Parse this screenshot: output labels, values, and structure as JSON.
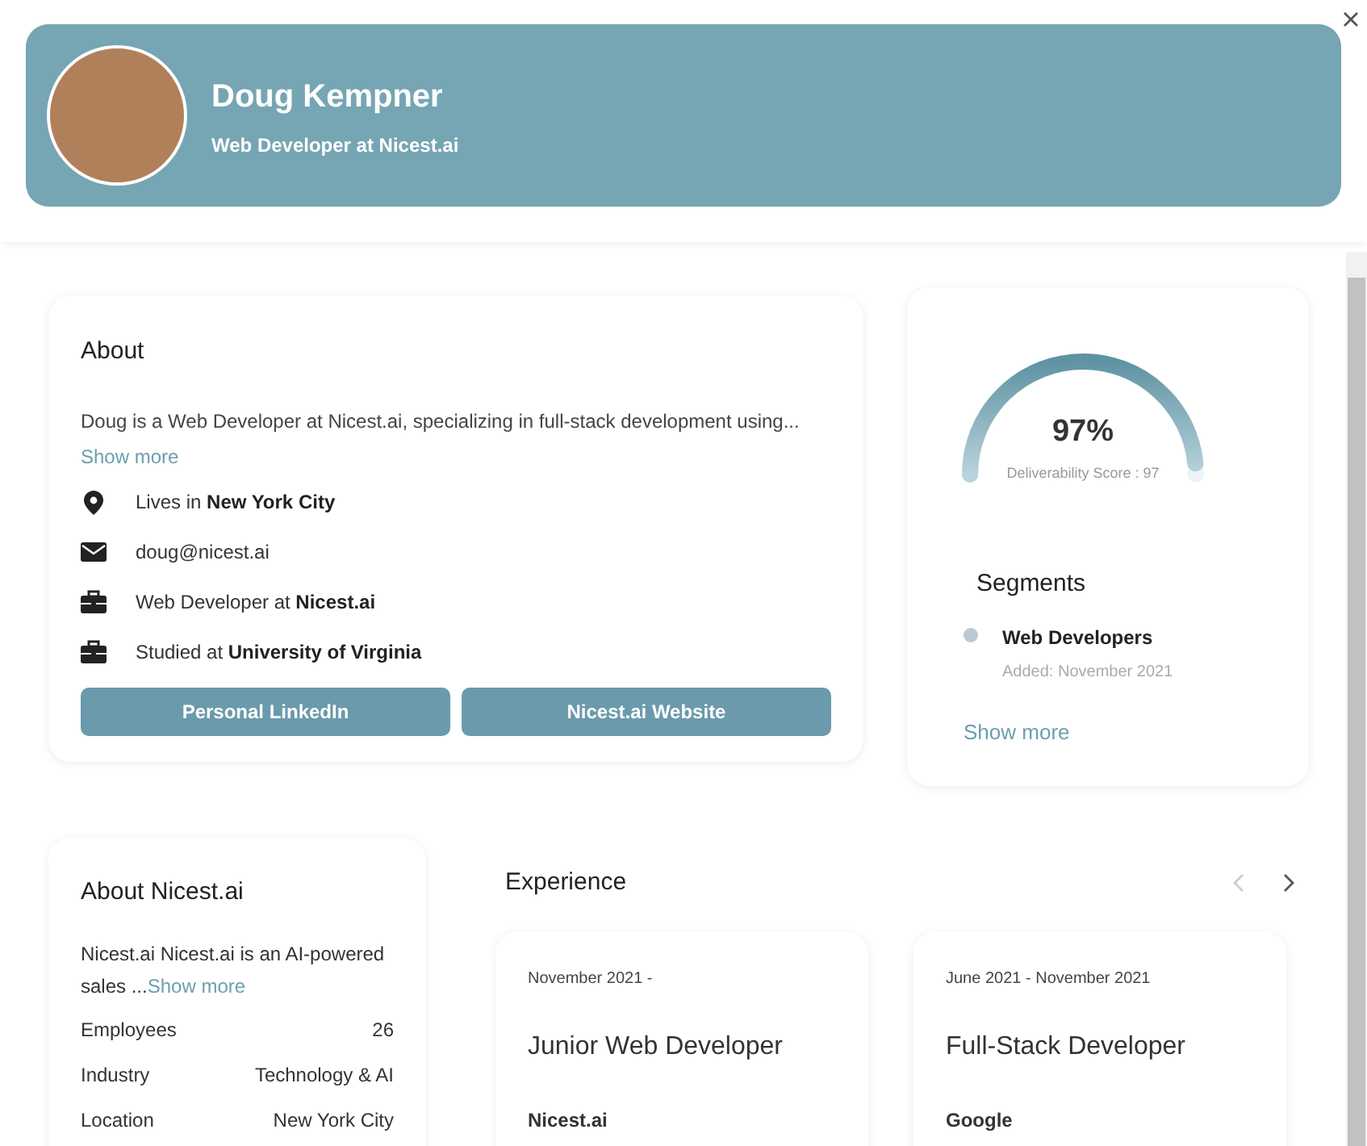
{
  "profile": {
    "name": "Doug Kempner",
    "headline": "Web Developer at Nicest.ai"
  },
  "about": {
    "title": "About",
    "summary": "Doug is a Web Developer at Nicest.ai, specializing in full-stack development using...",
    "show_more": "Show more",
    "details": [
      {
        "kind": "location",
        "text": "Lives in **New York City**"
      },
      {
        "kind": "email",
        "text": "doug@nicest.ai"
      },
      {
        "kind": "work",
        "text": "Web Developer at **Nicest.ai**"
      },
      {
        "kind": "education",
        "text": "Studied at **University of Virginia**"
      }
    ],
    "buttons": [
      "Personal LinkedIn",
      "Nicest.ai Website"
    ]
  },
  "score": {
    "value": "97%",
    "level": 0.97,
    "caption": "Deliverability Score : 97"
  },
  "segments": {
    "title": "Segments",
    "items": [
      {
        "name": "Web Developers",
        "added": "Added: November 2021"
      }
    ],
    "show_more": "Show more"
  },
  "company": {
    "title": "About Nicest.ai",
    "summary": "Nicest.ai Nicest.ai is an AI-powered sales ...",
    "show_more": "Show more",
    "facts": [
      {
        "label": "Employees",
        "value": "26"
      },
      {
        "label": "Industry",
        "value": "Technology & AI"
      },
      {
        "label": "Location",
        "value": "New York City"
      }
    ]
  },
  "experience": {
    "title": "Experience",
    "prev_disabled": true,
    "next_disabled": false,
    "items": [
      {
        "dates": "November 2021 -",
        "role": "Junior Web Developer",
        "company": "Nicest.ai"
      },
      {
        "dates": "June 2021 - November 2021",
        "role": "Full-Stack Developer",
        "company": "Google"
      }
    ]
  }
}
